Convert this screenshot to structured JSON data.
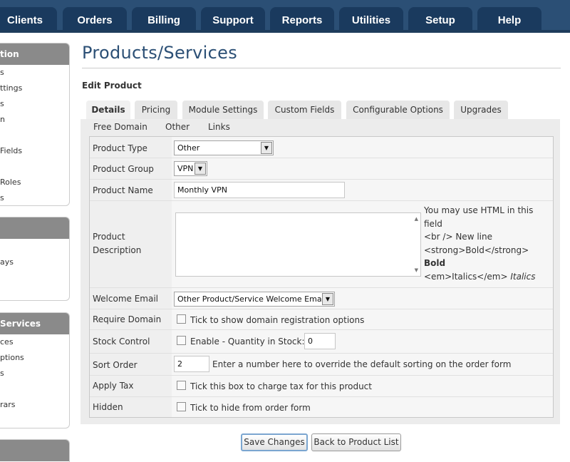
{
  "nav": {
    "tabs": [
      "Clients",
      "Orders",
      "Billing",
      "Support",
      "Reports",
      "Utilities",
      "Setup",
      "Help"
    ]
  },
  "sidebar": {
    "box1": {
      "title": "tion",
      "items": [
        "s",
        "ttings",
        "s",
        "n",
        "Fields",
        "Roles",
        "s"
      ]
    },
    "box2": {
      "title": "",
      "items": [
        "ays"
      ]
    },
    "box3": {
      "title": "Services",
      "items": [
        "ces",
        "ptions",
        "s",
        "rars"
      ]
    },
    "box4": {
      "title": ""
    }
  },
  "page": {
    "title": "Products/Services",
    "subtitle": "Edit Product"
  },
  "tabs": {
    "row1": [
      "Details",
      "Pricing",
      "Module Settings",
      "Custom Fields",
      "Configurable Options",
      "Upgrades"
    ],
    "row2": [
      "Free Domain",
      "Other",
      "Links"
    ],
    "active": "Details"
  },
  "form": {
    "product_type": {
      "label": "Product Type",
      "value": "Other"
    },
    "product_group": {
      "label": "Product Group",
      "value": "VPN"
    },
    "product_name": {
      "label": "Product Name",
      "value": "Monthly VPN"
    },
    "description": {
      "label_line1": "Product",
      "label_line2": "Description",
      "value": "",
      "help": {
        "line1": "You may use HTML in this",
        "line2": "field",
        "line3": "<br /> New line",
        "line4": "<strong>Bold</strong>",
        "line5": "Bold",
        "line6_code": "<em>Italics</em>",
        "line6_demo": "Italics"
      }
    },
    "welcome_email": {
      "label": "Welcome Email",
      "value": "Other Product/Service Welcome Email"
    },
    "require_domain": {
      "label": "Require Domain",
      "text": "Tick to show domain registration options",
      "checked": false
    },
    "stock_control": {
      "label": "Stock Control",
      "text": "Enable - Quantity in Stock:",
      "quantity": "0",
      "checked": false
    },
    "sort_order": {
      "label": "Sort Order",
      "value": "2",
      "text": "Enter a number here to override the default sorting on the order form"
    },
    "apply_tax": {
      "label": "Apply Tax",
      "text": "Tick this box to charge tax for this product",
      "checked": false
    },
    "hidden": {
      "label": "Hidden",
      "text": "Tick to hide from order form",
      "checked": false
    }
  },
  "buttons": {
    "save": "Save Changes",
    "back": "Back to Product List"
  }
}
